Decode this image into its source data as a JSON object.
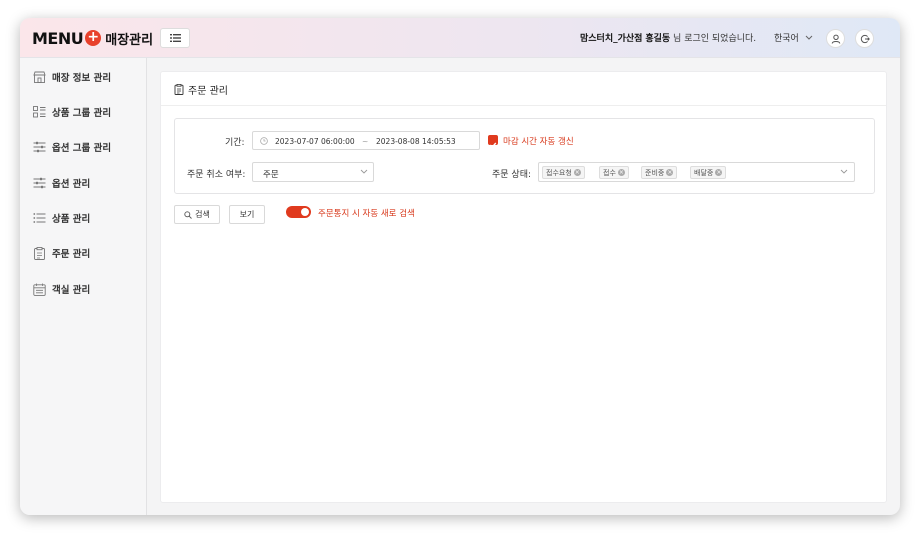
{
  "header": {
    "logo_word": "MENU",
    "logo_plus": "+",
    "logo_sub": "매장관리",
    "store_name": "맘스터치_가산점",
    "user_name": "홍길동",
    "login_suffix": " 님 로그인 되었습니다.",
    "language": "한국어"
  },
  "sidebar": {
    "items": [
      {
        "label": "매장 정보 관리",
        "icon": "store-icon"
      },
      {
        "label": "상품 그룹 관리",
        "icon": "grid-list-icon"
      },
      {
        "label": "옵션 그룹 관리",
        "icon": "sliders-icon"
      },
      {
        "label": "옵션 관리",
        "icon": "sliders-icon"
      },
      {
        "label": "상품 관리",
        "icon": "list-icon"
      },
      {
        "label": "주문 관리",
        "icon": "clipboard-icon"
      },
      {
        "label": "객실 관리",
        "icon": "calendar-icon"
      }
    ]
  },
  "main": {
    "title": "주문 관리",
    "filters": {
      "period_label": "기간:",
      "start_datetime": "2023-07-07 06:00:00",
      "range_separator": "~",
      "end_datetime": "2023-08-08 14:05:53",
      "auto_refresh_label": "마감 시간 자동 갱신",
      "auto_refresh_checked": true,
      "cancel_label": "주문 취소 여부:",
      "cancel_value": "주문",
      "status_label": "주문 상태:",
      "status_tags": [
        "접수요청",
        "접수",
        "준비중",
        "배달중"
      ]
    },
    "actions": {
      "search_label": "검색",
      "view_label": "보기",
      "auto_search_label": "주문통지 시 자동 새로 검색",
      "auto_search_on": true
    }
  },
  "colors": {
    "accent": "#e03a1e",
    "logo_plus": "#e8412c"
  }
}
